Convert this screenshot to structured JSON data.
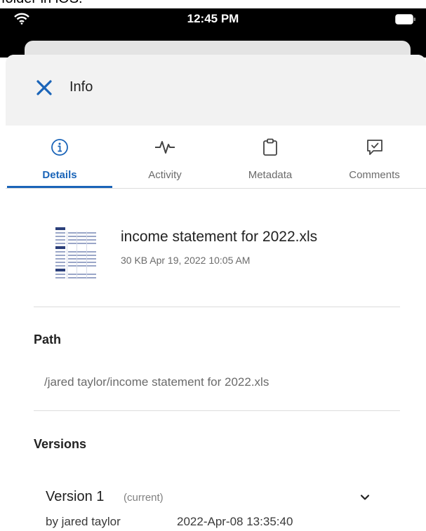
{
  "caption": "folder in iOS.",
  "status_bar": {
    "time": "12:45 PM"
  },
  "header": {
    "title": "Info",
    "close_icon": "close-icon"
  },
  "tabs": [
    {
      "label": "Details",
      "icon": "info-icon",
      "active": true
    },
    {
      "label": "Activity",
      "icon": "activity-pulse-icon",
      "active": false
    },
    {
      "label": "Metadata",
      "icon": "clipboard-icon",
      "active": false
    },
    {
      "label": "Comments",
      "icon": "comment-check-icon",
      "active": false
    }
  ],
  "file": {
    "name": "income statement for 2022.xls",
    "meta": "30 KB Apr 19, 2022 10:05 AM"
  },
  "path": {
    "title": "Path",
    "value": "/jared taylor/income statement for 2022.xls"
  },
  "versions": {
    "title": "Versions",
    "items": [
      {
        "name": "Version 1",
        "tag": "(current)",
        "by": "by jared taylor",
        "date": "2022-Apr-08 13:35:40"
      }
    ]
  },
  "colors": {
    "accent": "#1a64b8",
    "header_bg": "#f2f2f2",
    "muted_text": "#6b6b6b"
  }
}
